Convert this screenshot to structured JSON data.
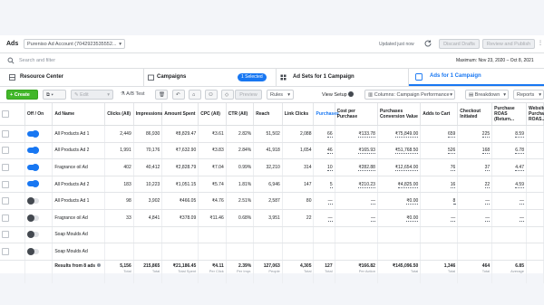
{
  "header": {
    "app_title": "Ads",
    "account": "Pureniso Ad Account (7042923535552...",
    "updated": "Updated just now",
    "discard": "Discard Drafts",
    "review": "Review and Publish"
  },
  "search": {
    "placeholder": "Search and filter",
    "date_range": "Maximum: Nov 23, 2020 – Oct 8, 2021"
  },
  "tabs": {
    "resource_center": "Resource Center",
    "campaigns": "Campaigns",
    "selected_badge": "1 Selected",
    "ad_sets": "Ad Sets for 1 Campaign",
    "ads": "Ads for 1 Campaign"
  },
  "toolbar": {
    "create": "Create",
    "edit": "Edit",
    "ab_test": "A/B Test",
    "preview": "Preview",
    "rules": "Rules",
    "view_setup": "View Setup",
    "columns": "Columns: Campaign Performance",
    "breakdown": "Breakdown",
    "reports": "Reports"
  },
  "columns": [
    {
      "label": "Off / On",
      "sub": ""
    },
    {
      "label": "Ad Name",
      "sub": ""
    },
    {
      "label": "Clicks (All)",
      "sub": ""
    },
    {
      "label": "Impressions",
      "sub": ""
    },
    {
      "label": "Amount Spent",
      "sub": ""
    },
    {
      "label": "CPC (All)",
      "sub": ""
    },
    {
      "label": "CTR (All)",
      "sub": ""
    },
    {
      "label": "Reach",
      "sub": ""
    },
    {
      "label": "Link Clicks",
      "sub": ""
    },
    {
      "label": "Purchases",
      "sub": ""
    },
    {
      "label": "Cost per Purchase",
      "sub": ""
    },
    {
      "label": "Purchases Conversion Value",
      "sub": ""
    },
    {
      "label": "Adds to Cart",
      "sub": ""
    },
    {
      "label": "Checkout Initiated",
      "sub": ""
    },
    {
      "label": "Purchase ROAS (Return...",
      "sub": ""
    },
    {
      "label": "Website Purchase ROAS...",
      "sub": ""
    }
  ],
  "rows": [
    {
      "on": true,
      "name": "All Products Ad 1",
      "clicks": "2,449",
      "impressions": "86,930",
      "spent": "₹8,829.47",
      "cpc": "₹3.61",
      "ctr": "2.82%",
      "reach": "51,502",
      "link_clicks": "2,088",
      "purchases": "66",
      "cost_per_purchase": "₹133.78",
      "conv_value": "₹75,849.00",
      "adds_to_cart": "659",
      "checkout": "225",
      "roas": "8.59",
      "web_roas": ""
    },
    {
      "on": true,
      "name": "All Products Ad 2",
      "clicks": "1,991",
      "impressions": "70,176",
      "spent": "₹7,632.90",
      "cpc": "₹3.83",
      "ctr": "2.84%",
      "reach": "41,918",
      "link_clicks": "1,654",
      "purchases": "46",
      "cost_per_purchase": "₹165.93",
      "conv_value": "₹51,768.50",
      "adds_to_cart": "526",
      "checkout": "168",
      "roas": "6.78",
      "web_roas": ""
    },
    {
      "on": true,
      "name": "Fragrance oil Ad",
      "clicks": "402",
      "impressions": "40,412",
      "spent": "₹2,828.79",
      "cpc": "₹7.04",
      "ctr": "0.99%",
      "reach": "32,210",
      "link_clicks": "314",
      "purchases": "10",
      "cost_per_purchase": "₹282.88",
      "conv_value": "₹12,654.00",
      "adds_to_cart": "76",
      "checkout": "37",
      "roas": "4.47",
      "web_roas": ""
    },
    {
      "on": true,
      "name": "All Products Ad 2",
      "clicks": "183",
      "impressions": "10,223",
      "spent": "₹1,051.15",
      "cpc": "₹5.74",
      "ctr": "1.81%",
      "reach": "6,946",
      "link_clicks": "147",
      "purchases": "5",
      "cost_per_purchase": "₹210.23",
      "conv_value": "₹4,825.00",
      "adds_to_cart": "16",
      "checkout": "22",
      "roas": "4.59",
      "web_roas": ""
    },
    {
      "on": false,
      "name": "All Products Ad 1",
      "clicks": "98",
      "impressions": "3,902",
      "spent": "₹466.05",
      "cpc": "₹4.76",
      "ctr": "2.51%",
      "reach": "2,587",
      "link_clicks": "80",
      "purchases": "—",
      "cost_per_purchase": "—",
      "conv_value": "₹0.00",
      "adds_to_cart": "8",
      "checkout": "—",
      "roas": "—",
      "web_roas": ""
    },
    {
      "on": false,
      "name": "Fragrance oil Ad",
      "clicks": "33",
      "impressions": "4,841",
      "spent": "₹378.09",
      "cpc": "₹11.46",
      "ctr": "0.68%",
      "reach": "3,951",
      "link_clicks": "22",
      "purchases": "—",
      "cost_per_purchase": "—",
      "conv_value": "₹0.00",
      "adds_to_cart": "—",
      "checkout": "—",
      "roas": "—",
      "web_roas": ""
    },
    {
      "on": false,
      "name": "Soap Moulds Ad",
      "clicks": "",
      "impressions": "",
      "spent": "",
      "cpc": "",
      "ctr": "",
      "reach": "",
      "link_clicks": "",
      "purchases": "",
      "cost_per_purchase": "",
      "conv_value": "",
      "adds_to_cart": "",
      "checkout": "",
      "roas": "",
      "web_roas": ""
    },
    {
      "on": false,
      "name": "Soap Moulds Ad",
      "clicks": "",
      "impressions": "",
      "spent": "",
      "cpc": "",
      "ctr": "",
      "reach": "",
      "link_clicks": "",
      "purchases": "",
      "cost_per_purchase": "",
      "conv_value": "",
      "adds_to_cart": "",
      "checkout": "",
      "roas": "",
      "web_roas": ""
    }
  ],
  "totals": {
    "label": "Results from 8 ads",
    "clicks": "5,156",
    "clicks_sub": "Total",
    "impressions": "215,865",
    "impressions_sub": "Total",
    "spent": "₹21,186.45",
    "spent_sub": "Total Spent",
    "cpc": "₹4.11",
    "cpc_sub": "Per Click",
    "ctr": "2.39%",
    "ctr_sub": "Per Impr.",
    "reach": "127,063",
    "reach_sub": "People",
    "link_clicks": "4,305",
    "link_clicks_sub": "Total",
    "purchases": "127",
    "purchases_sub": "Total",
    "cost_per_purchase": "₹166.82",
    "cost_per_purchase_sub": "Per Action",
    "conv_value": "₹145,096.50",
    "conv_value_sub": "Total",
    "adds_to_cart": "1,346",
    "adds_to_cart_sub": "Total",
    "checkout": "464",
    "checkout_sub": "Total",
    "roas": "6.85",
    "roas_sub": "Average"
  },
  "colors": {
    "accent": "#1877f2",
    "create": "#42b72a",
    "page_bg": "#f3f5f9"
  }
}
